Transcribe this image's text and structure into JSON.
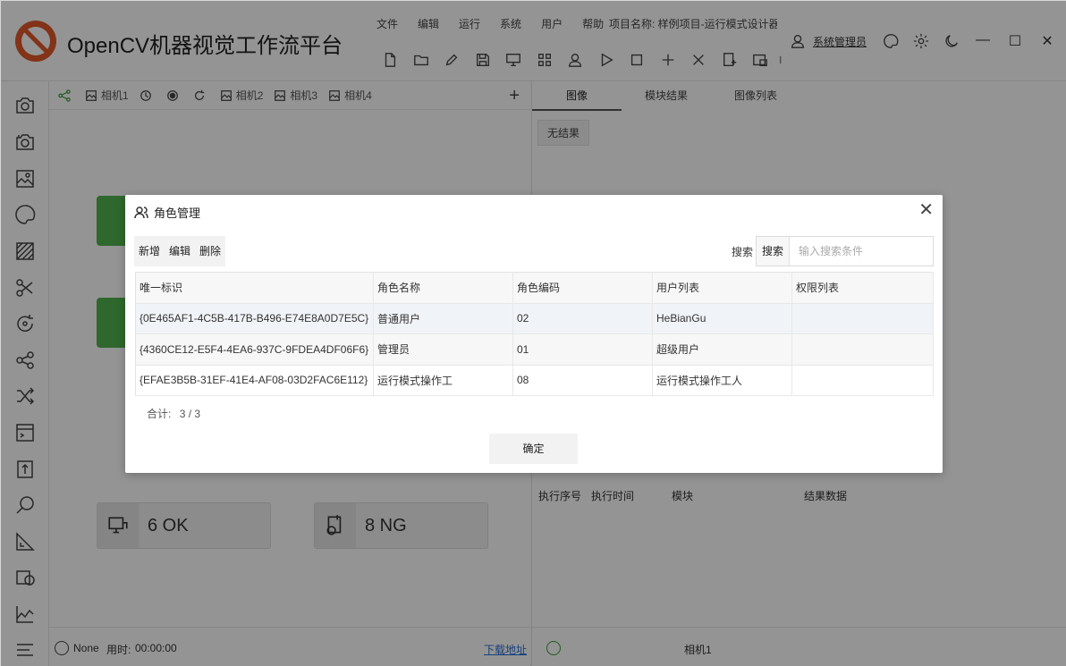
{
  "app": {
    "title": "OpenCV机器视觉工作流平台"
  },
  "menu": [
    "文件",
    "编辑",
    "运行",
    "系统",
    "用户",
    "帮助"
  ],
  "project": "项目名称: 样例项目-运行模式设计器",
  "user": {
    "name": "系统管理员"
  },
  "window_controls": {
    "minimize": "—",
    "maximize": "☐",
    "close": "✕"
  },
  "canvas": {
    "tabs": [
      "相机1",
      "相机2",
      "相机3",
      "相机4"
    ],
    "add": "+",
    "nodes": [
      {
        "label": "6 OK",
        "icon": "monitor-icon"
      },
      {
        "label": "8 NG",
        "icon": "device-error-icon"
      }
    ],
    "status": {
      "run": "None",
      "elapsed_label": "用时:",
      "elapsed": "00:00:00",
      "download": "下载地址"
    }
  },
  "right_panel": {
    "tabs": [
      "图像",
      "模块结果",
      "图像列表"
    ],
    "no_result": "无结果",
    "columns": [
      "执行序号",
      "执行时间",
      "模块",
      "结果数据"
    ],
    "camera": "相机1"
  },
  "dialog": {
    "title": "角色管理",
    "close": "✕",
    "actions": {
      "add": "新增",
      "edit": "编辑",
      "delete": "删除"
    },
    "search": {
      "label": "搜索",
      "button": "搜索",
      "placeholder": "输入搜索条件"
    },
    "table": {
      "headers": [
        "唯一标识",
        "角色名称",
        "角色编码",
        "用户列表",
        "权限列表"
      ],
      "rows": [
        [
          "{0E465AF1-4C5B-417B-B496-E74E8A0D7E5C}",
          "普通用户",
          "02",
          "HeBianGu",
          ""
        ],
        [
          "{4360CE12-E5F4-4EA6-937C-9FDEA4DF06F6}",
          "管理员",
          "01",
          "超级用户",
          ""
        ],
        [
          "{EFAE3B5B-31EF-41E4-AF08-03D2FAC6E112}",
          "运行模式操作工",
          "08",
          "运行模式操作工人",
          ""
        ]
      ]
    },
    "total_label": "合计:",
    "total": "3 / 3",
    "confirm": "确定"
  }
}
